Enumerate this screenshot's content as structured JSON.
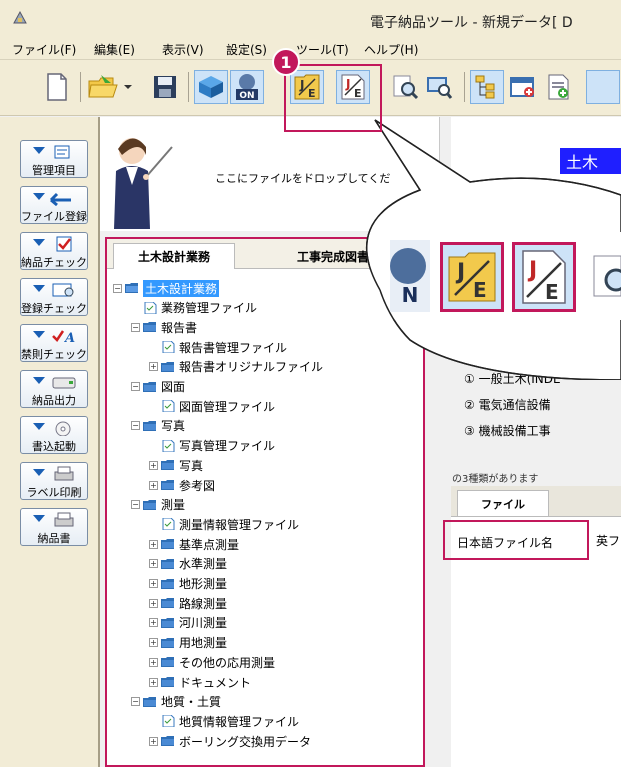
{
  "window": {
    "title": "電子納品ツール - 新規データ[ D"
  },
  "menu": {
    "items": [
      "ファイル(F)",
      "編集(E)",
      "表示(V)",
      "設定(S)",
      "ツール(T)",
      "ヘルプ(H)"
    ]
  },
  "toolbar": {
    "icons": [
      "new-file-icon",
      "open-folder-icon",
      "save-icon",
      "check-icon",
      "online-icon",
      "je-convert-icon",
      "je-convert-alt-icon",
      "search-icon",
      "search-alt-icon",
      "tree-icon",
      "window-icon",
      "add-doc-icon"
    ],
    "callout_number": "1"
  },
  "rail": {
    "buttons": [
      "管理項目",
      "ファイル登録",
      "納品チェック",
      "登録チェック",
      "禁則チェック",
      "納品出力",
      "書込起動",
      "ラベル印刷",
      "納品書"
    ]
  },
  "drop_hint": "ここにファイルをドロップしてくだ",
  "tree": {
    "tabs": [
      "土木設計業務",
      "工事完成図書"
    ],
    "items": [
      {
        "label": "土木設計業務",
        "level": 0,
        "type": "root",
        "selected": true
      },
      {
        "label": "業務管理ファイル",
        "level": 1,
        "type": "file"
      },
      {
        "label": "報告書",
        "level": 1,
        "type": "folder"
      },
      {
        "label": "報告書管理ファイル",
        "level": 2,
        "type": "file"
      },
      {
        "label": "報告書オリジナルファイル",
        "level": 2,
        "type": "folder"
      },
      {
        "label": "図面",
        "level": 1,
        "type": "folder"
      },
      {
        "label": "図面管理ファイル",
        "level": 2,
        "type": "file"
      },
      {
        "label": "写真",
        "level": 1,
        "type": "folder"
      },
      {
        "label": "写真管理ファイル",
        "level": 2,
        "type": "file"
      },
      {
        "label": "写真",
        "level": 2,
        "type": "folder"
      },
      {
        "label": "参考図",
        "level": 2,
        "type": "folder"
      },
      {
        "label": "測量",
        "level": 1,
        "type": "folder"
      },
      {
        "label": "測量情報管理ファイル",
        "level": 2,
        "type": "file"
      },
      {
        "label": "基準点測量",
        "level": 2,
        "type": "folder"
      },
      {
        "label": "水準測量",
        "level": 2,
        "type": "folder"
      },
      {
        "label": "地形測量",
        "level": 2,
        "type": "folder"
      },
      {
        "label": "路線測量",
        "level": 2,
        "type": "folder"
      },
      {
        "label": "河川測量",
        "level": 2,
        "type": "folder"
      },
      {
        "label": "用地測量",
        "level": 2,
        "type": "folder"
      },
      {
        "label": "その他の応用測量",
        "level": 2,
        "type": "folder"
      },
      {
        "label": "ドキュメント",
        "level": 2,
        "type": "folder"
      },
      {
        "label": "地質・土質",
        "level": 1,
        "type": "folder"
      },
      {
        "label": "地質情報管理ファイル",
        "level": 2,
        "type": "file"
      },
      {
        "label": "ボーリング交換用データ",
        "level": 2,
        "type": "folder"
      }
    ]
  },
  "right": {
    "heading": "土木",
    "list": [
      "① 一般土木(INDE",
      "② 電気通信設備",
      "③ 機械設備工事"
    ],
    "partial_line": "の3種類があります",
    "file_tab": "ファイル",
    "columns": [
      "日本語ファイル名",
      "英ファイル"
    ]
  }
}
